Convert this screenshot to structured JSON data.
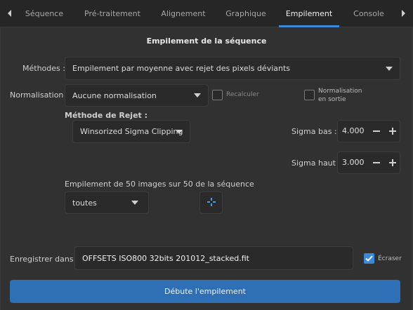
{
  "tabs": {
    "items": [
      {
        "label": "Séquence"
      },
      {
        "label": "Pré-traitement"
      },
      {
        "label": "Alignement"
      },
      {
        "label": "Graphique"
      },
      {
        "label": "Empilement"
      },
      {
        "label": "Console"
      }
    ],
    "active": "Empilement"
  },
  "stacking": {
    "title": "Empilement de la séquence",
    "methods_label": "Méthodes :",
    "method_value": "Empilement par moyenne avec rejet des pixels déviants",
    "normalization_label": "Normalisation :",
    "normalization_value": "Aucune normalisation",
    "recalc_label": "Recalculer",
    "recalc_checked": false,
    "output_norm_label_1": "Normalisation",
    "output_norm_label_2": "en sortie",
    "output_norm_checked": false,
    "rejection_title": "Méthode de Rejet :",
    "rejection_value": "Winsorized Sigma Clipping",
    "sigma_low_label": "Sigma bas :",
    "sigma_low_value": "4.000",
    "sigma_high_label": "Sigma haut :",
    "sigma_high_value": "3.000",
    "images_info": "Empilement de 50 images sur 50 de la séquence",
    "images_filter_value": "toutes",
    "save_label": "Enregistrer dans :",
    "save_value": "OFFSETS ISO800 32bits 201012_stacked.fit",
    "overwrite_label": "Écraser",
    "overwrite_checked": true,
    "start_button": "Débute l'empilement"
  },
  "colors": {
    "accent": "#3b88d8",
    "primary_button": "#2f6fb6"
  },
  "icons": {
    "tab_left": "chevron-left-icon",
    "tab_right": "chevron-right-icon",
    "filter_add": "plus-crosshair-icon"
  }
}
